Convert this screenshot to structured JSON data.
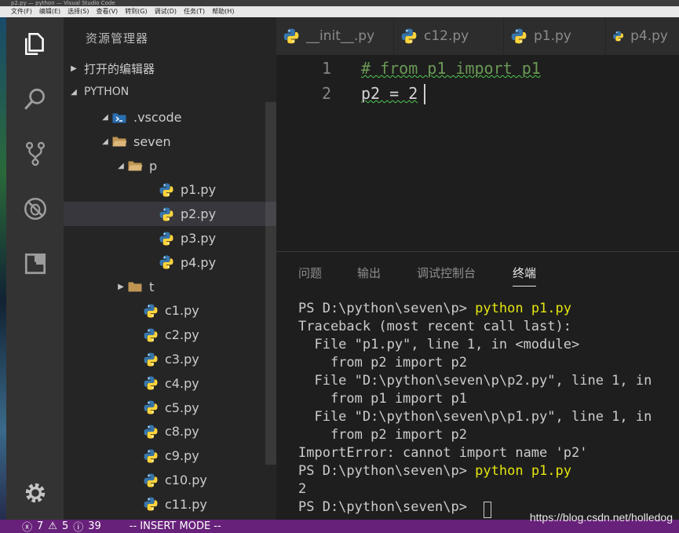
{
  "window": {
    "title": "p2.py — python — Visual Studio Code",
    "menu": [
      "文件(F)",
      "编辑(E)",
      "选择(S)",
      "查看(V)",
      "转到(G)",
      "调试(D)",
      "任务(T)",
      "帮助(H)"
    ]
  },
  "activity_bar": [
    "files-icon",
    "search-icon",
    "source-control-icon",
    "debug-icon",
    "extensions-icon",
    "gear-icon"
  ],
  "sidebar": {
    "title": "资源管理器",
    "open_editors_label": "打开的编辑器",
    "project_label": "PYTHON",
    "tree": [
      {
        "name": ".vscode",
        "type": "vscode-folder",
        "expanded": true
      },
      {
        "name": "seven",
        "type": "folder",
        "expanded": true
      },
      {
        "name": "p",
        "type": "folder",
        "expanded": true
      },
      {
        "name": "p1.py",
        "type": "python-file"
      },
      {
        "name": "p2.py",
        "type": "python-file",
        "selected": true
      },
      {
        "name": "p3.py",
        "type": "python-file"
      },
      {
        "name": "p4.py",
        "type": "python-file"
      },
      {
        "name": "t",
        "type": "folder",
        "expanded": false
      },
      {
        "name": "c1.py",
        "type": "python-file"
      },
      {
        "name": "c2.py",
        "type": "python-file"
      },
      {
        "name": "c3.py",
        "type": "python-file"
      },
      {
        "name": "c4.py",
        "type": "python-file"
      },
      {
        "name": "c5.py",
        "type": "python-file"
      },
      {
        "name": "c8.py",
        "type": "python-file"
      },
      {
        "name": "c9.py",
        "type": "python-file"
      },
      {
        "name": "c10.py",
        "type": "python-file"
      },
      {
        "name": "c11.py",
        "type": "python-file"
      }
    ]
  },
  "tabs": [
    {
      "label": "__init__.py"
    },
    {
      "label": "c12.py"
    },
    {
      "label": "p1.py"
    },
    {
      "label": "p4.py"
    }
  ],
  "editor": {
    "lines": [
      {
        "number": "1",
        "text": "# from p1 import p1"
      },
      {
        "number": "2",
        "text": "p2 = 2"
      }
    ]
  },
  "panel": {
    "tabs": [
      {
        "label": "问题",
        "active": false
      },
      {
        "label": "输出",
        "active": false
      },
      {
        "label": "调试控制台",
        "active": false
      },
      {
        "label": "终端",
        "active": true
      }
    ],
    "terminal_lines": [
      {
        "prompt": "PS D:\\python\\seven\\p> ",
        "command": "python p1.py"
      },
      {
        "text": "Traceback (most recent call last):"
      },
      {
        "text": "  File \"p1.py\", line 1, in <module>"
      },
      {
        "text": "    from p2 import p2"
      },
      {
        "text": "  File \"D:\\python\\seven\\p\\p2.py\", line 1, in"
      },
      {
        "text": "    from p1 import p1"
      },
      {
        "text": "  File \"D:\\python\\seven\\p\\p1.py\", line 1, in"
      },
      {
        "text": "    from p2 import p2"
      },
      {
        "text": "ImportError: cannot import name 'p2'"
      },
      {
        "prompt": "PS D:\\python\\seven\\p> ",
        "command": "python p1.py"
      },
      {
        "text": "2"
      },
      {
        "prompt": "PS D:\\python\\seven\\p> ",
        "command": ""
      }
    ]
  },
  "status": {
    "errors": "7",
    "warnings": "5",
    "info": "39",
    "mode": "-- INSERT MODE --"
  },
  "watermark": "https://blog.csdn.net/holledog",
  "colors": {
    "status_bar": "#68217a",
    "terminal_command": "#e5e510",
    "comment": "#6a9955",
    "python_blue": "#3776ab",
    "python_yellow": "#ffd43b"
  }
}
